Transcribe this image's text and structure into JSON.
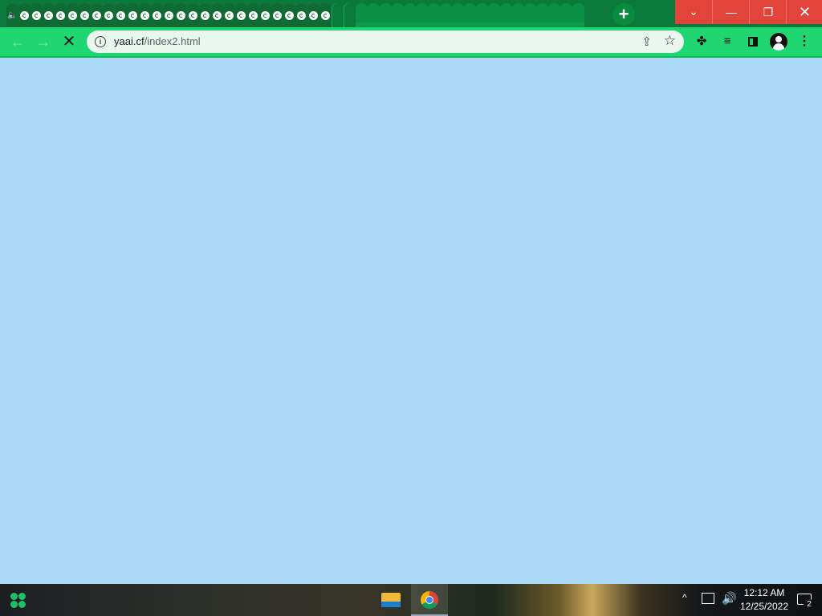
{
  "browser": {
    "tab_count_visible": 56,
    "new_tab_label": "+",
    "window_controls": {
      "tab_search": "⌄",
      "minimize": "—",
      "restore": "❐",
      "close": "✕"
    },
    "toolbar": {
      "back": "←",
      "forward": "→",
      "stop": "✕",
      "url_host": "yaai.cf",
      "url_path": "/index2.html",
      "share_icon": "⇪",
      "bookmark_icon": "☆",
      "extensions_icon": "✤",
      "media_icon": "≡",
      "menu_icon": "⋮"
    },
    "accent_colors": {
      "tabstrip": "#0a7a3a",
      "toolbar": "#1fd670",
      "window_controls": "#e0443a",
      "page_background": "#aad9f5"
    }
  },
  "taskbar": {
    "tray_expand": "^",
    "volume_icon": "🔊",
    "clock_time": "12:12 AM",
    "clock_date": "12/25/2022",
    "notification_count": "2"
  }
}
